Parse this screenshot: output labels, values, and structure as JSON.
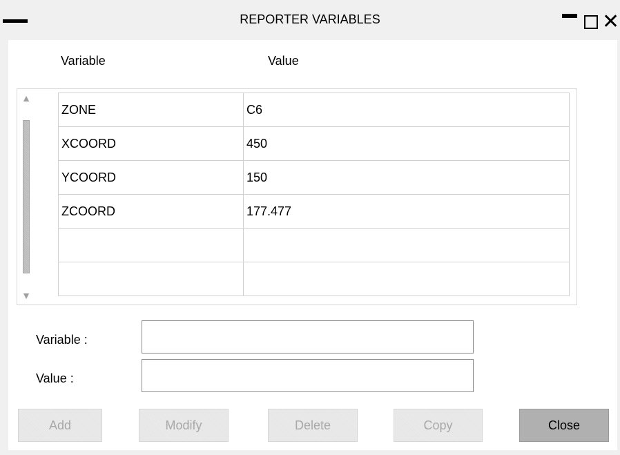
{
  "window": {
    "title": "REPORTER VARIABLES"
  },
  "table": {
    "headers": [
      "Variable",
      "Value"
    ],
    "rows": [
      {
        "variable": "ZONE",
        "value": "C6"
      },
      {
        "variable": "XCOORD",
        "value": "450"
      },
      {
        "variable": "YCOORD",
        "value": "150"
      },
      {
        "variable": "ZCOORD",
        "value": "177.477"
      },
      {
        "variable": "",
        "value": ""
      },
      {
        "variable": "",
        "value": ""
      }
    ]
  },
  "form": {
    "variable_label": "Variable :",
    "variable_value": "",
    "value_label": "Value :",
    "value_value": ""
  },
  "buttons": {
    "add": "Add",
    "modify": "Modify",
    "delete": "Delete",
    "copy": "Copy",
    "close": "Close"
  },
  "colors": {
    "background": "#f0f0f0",
    "panel": "#ffffff",
    "disabled_text": "#a8a8a8",
    "close_button": "#b0b0b0"
  }
}
